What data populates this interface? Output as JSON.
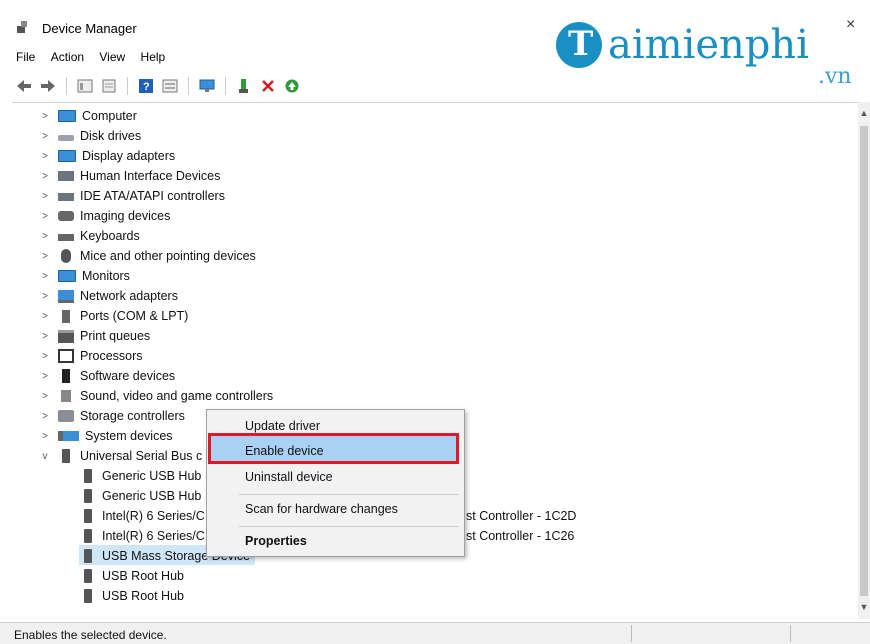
{
  "window": {
    "title": "Device Manager",
    "close_glyph": "×"
  },
  "watermark": {
    "initial": "T",
    "word": "aimienphi",
    "suffix": ".vn"
  },
  "menu": {
    "file": "File",
    "action": "Action",
    "view": "View",
    "help": "Help"
  },
  "toolbar": {
    "icons": [
      "back-icon",
      "forward-icon",
      "show-hide-tree-icon",
      "properties-icon",
      "help-icon",
      "view-icon",
      "display-icon",
      "update-driver-icon",
      "uninstall-icon",
      "enable-device-icon"
    ]
  },
  "tree": {
    "categories": [
      {
        "label": "Computer",
        "icon": "computer-icon"
      },
      {
        "label": "Disk drives",
        "icon": "disk-drive-icon"
      },
      {
        "label": "Display adapters",
        "icon": "display-adapter-icon"
      },
      {
        "label": "Human Interface Devices",
        "icon": "hid-icon"
      },
      {
        "label": "IDE ATA/ATAPI controllers",
        "icon": "ide-controller-icon"
      },
      {
        "label": "Imaging devices",
        "icon": "camera-icon"
      },
      {
        "label": "Keyboards",
        "icon": "keyboard-icon"
      },
      {
        "label": "Mice and other pointing devices",
        "icon": "mouse-icon"
      },
      {
        "label": "Monitors",
        "icon": "monitor-icon"
      },
      {
        "label": "Network adapters",
        "icon": "network-icon"
      },
      {
        "label": "Ports (COM & LPT)",
        "icon": "port-icon"
      },
      {
        "label": "Print queues",
        "icon": "printer-icon"
      },
      {
        "label": "Processors",
        "icon": "processor-icon"
      },
      {
        "label": "Software devices",
        "icon": "software-device-icon"
      },
      {
        "label": "Sound, video and game controllers",
        "icon": "speaker-icon"
      },
      {
        "label": "Storage controllers",
        "icon": "storage-icon"
      },
      {
        "label": "System devices",
        "icon": "system-device-icon"
      },
      {
        "label": "Universal Serial Bus c",
        "icon": "usb-icon"
      }
    ],
    "usb_children": [
      {
        "label": "Generic USB Hub",
        "suffix": ""
      },
      {
        "label": "Generic USB Hub",
        "suffix": ""
      },
      {
        "label": "Intel(R) 6 Series/C",
        "suffix": "st Controller - 1C2D"
      },
      {
        "label": "Intel(R) 6 Series/C",
        "suffix": "st Controller - 1C26"
      },
      {
        "label": "USB Mass Storage Device",
        "suffix": ""
      },
      {
        "label": "USB Root Hub",
        "suffix": ""
      },
      {
        "label": "USB Root Hub",
        "suffix": ""
      }
    ]
  },
  "context_menu": {
    "update_driver": "Update driver",
    "enable_device": "Enable device",
    "uninstall_device": "Uninstall device",
    "scan": "Scan for hardware changes",
    "properties": "Properties",
    "highlight_color": "#e0182a"
  },
  "status": {
    "text": "Enables the selected device."
  }
}
